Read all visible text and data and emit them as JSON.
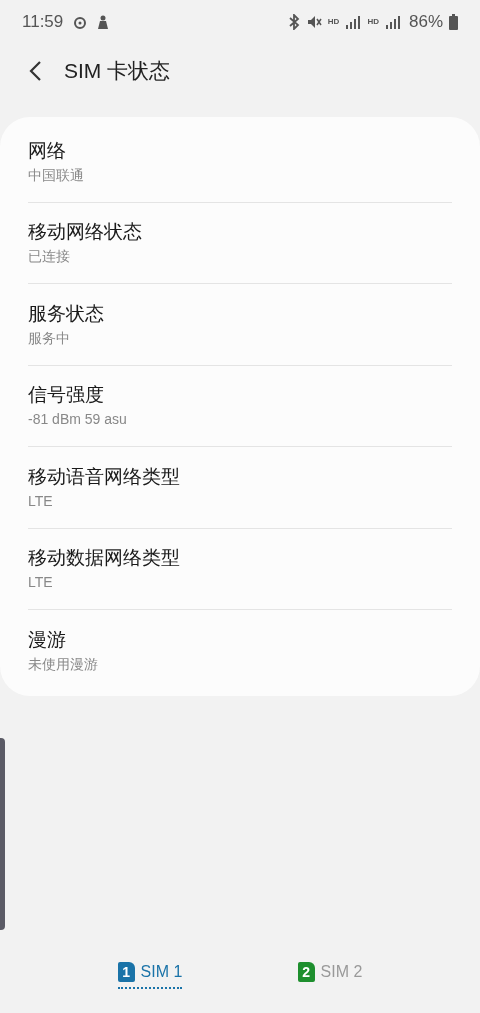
{
  "status_bar": {
    "time": "11:59",
    "battery": "86%",
    "signals": [
      "HD",
      "HD"
    ]
  },
  "header": {
    "title": "SIM 卡状态"
  },
  "items": [
    {
      "title": "网络",
      "value": "中国联通"
    },
    {
      "title": "移动网络状态",
      "value": "已连接"
    },
    {
      "title": "服务状态",
      "value": "服务中"
    },
    {
      "title": "信号强度",
      "value": "-81 dBm 59 asu"
    },
    {
      "title": "移动语音网络类型",
      "value": "LTE"
    },
    {
      "title": "移动数据网络类型",
      "value": "LTE"
    },
    {
      "title": "漫游",
      "value": "未使用漫游"
    }
  ],
  "tabs": [
    {
      "badge": "1",
      "label": "SIM 1",
      "selected": true,
      "color": "#1a73a8"
    },
    {
      "badge": "2",
      "label": "SIM 2",
      "selected": false,
      "color": "#1e8f2e"
    }
  ]
}
